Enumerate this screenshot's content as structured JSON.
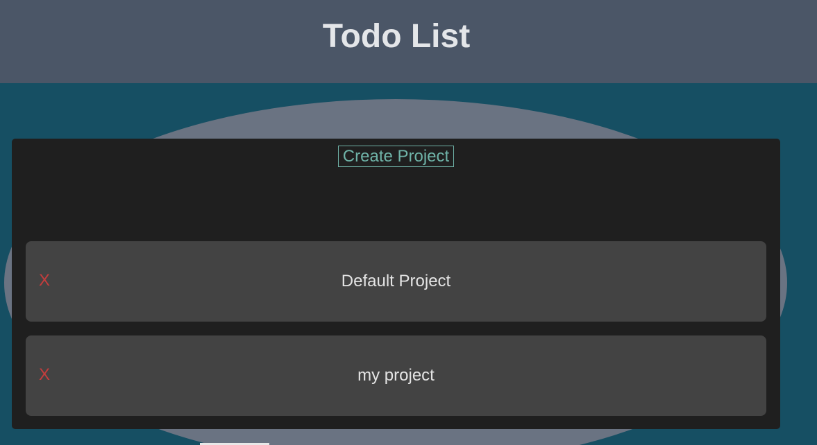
{
  "header": {
    "title": "Todo List"
  },
  "toolbar": {
    "create_label": "Create Project"
  },
  "projects": [
    {
      "delete_label": "X",
      "name": "Default Project"
    },
    {
      "delete_label": "X",
      "name": "my project"
    }
  ],
  "colors": {
    "header_bg": "#4b5667",
    "page_bg": "#164f63",
    "panel_bg": "#1f1f1f",
    "card_bg": "#434343",
    "accent": "#6fb3a8",
    "delete": "#c43d3d"
  }
}
